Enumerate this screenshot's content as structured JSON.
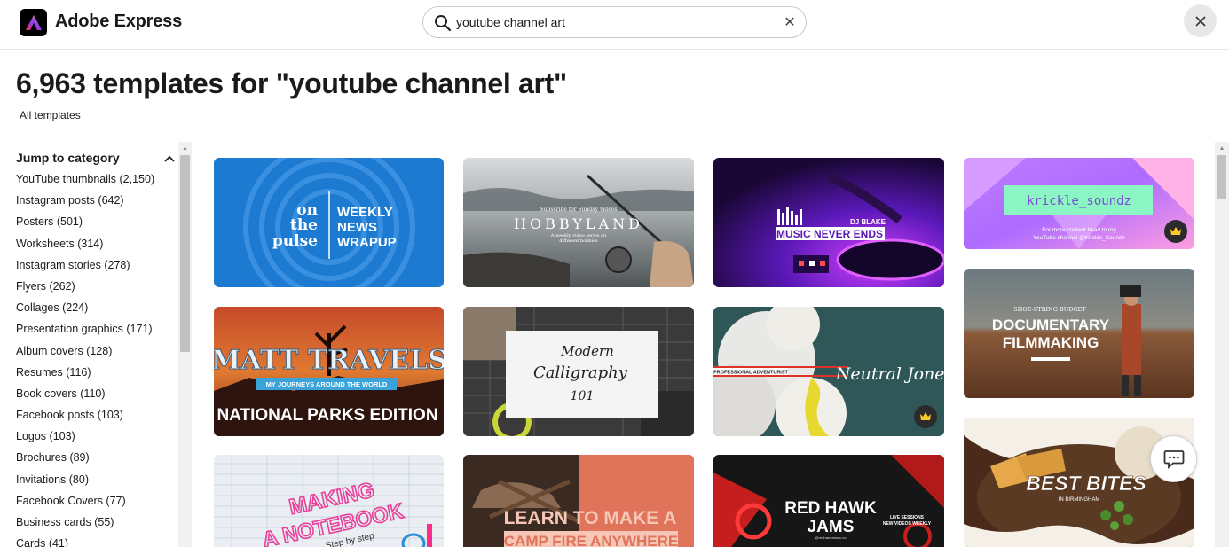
{
  "app": {
    "brand": "Adobe Express"
  },
  "search": {
    "value": "youtube channel art",
    "placeholder": ""
  },
  "page": {
    "title": "6,963 templates for \"youtube channel art\"",
    "breadcrumb": "All templates"
  },
  "sidebar": {
    "heading": "Jump to category",
    "items": [
      "YouTube thumbnails (2,150)",
      "Instagram posts (642)",
      "Posters (501)",
      "Worksheets (314)",
      "Instagram stories (278)",
      "Flyers (262)",
      "Collages (224)",
      "Presentation graphics (171)",
      "Album covers (128)",
      "Resumes (116)",
      "Book covers (110)",
      "Facebook posts (103)",
      "Logos (103)",
      "Brochures (89)",
      "Invitations (80)",
      "Facebook Covers (77)",
      "Business cards (55)",
      "Cards (41)"
    ]
  },
  "templates": {
    "t1": {
      "left": "on",
      "mid": "the",
      "bottom": "pulse",
      "right1": "WEEKLY",
      "right2": "NEWS",
      "right3": "WRAPUP"
    },
    "t2": {
      "small_top": "Subscribe for Sunday videos",
      "title": "HOBBYLAND",
      "sub1": "A weekly video series on",
      "sub2": "different hobbies"
    },
    "t3": {
      "artist": "DJ BLAKE",
      "title": "MUSIC NEVER ENDS"
    },
    "t4": {
      "title": "krickle_soundz",
      "sub1": "For more content head to my",
      "sub2": "YouTube channel @Krickle_Soundz"
    },
    "t5": {
      "title": "MATT TRAVELS",
      "ribbon": "MY JOURNEYS AROUND THE WORLD",
      "bottom": "NATIONAL PARKS EDITION"
    },
    "t6": {
      "line1": "Modern",
      "line2": "Calligraphy",
      "line3": "101"
    },
    "t7": {
      "tag": "PROFESSIONAL ADVENTURIST",
      "name": "Neutral Jones"
    },
    "t8": {
      "small": "SHOE-STRING BUDGET",
      "line1": "DOCUMENTARY",
      "line2": "FILMMAKING"
    },
    "t9": {
      "line1": "MAKING",
      "line2": "A NOTEBOOK",
      "line3": "Step by step"
    },
    "t10": {
      "line1": "LEARN TO MAKE A",
      "line2": "CAMP FIRE ANYWHERE"
    },
    "t11": {
      "line1": "RED HAWK",
      "line2": "JAMS",
      "right1": "LIVE SESSIONS",
      "right2": "NEW VIDEOS WEEKLY",
      "handle": "@redhawkmusic.co"
    },
    "t12": {
      "title": "BEST BITES",
      "sub": "IN BIRMINGHAM"
    }
  },
  "colors": {
    "accent": "#1473e6",
    "text": "#1a1a1a",
    "premium": "#2b2b2b"
  }
}
